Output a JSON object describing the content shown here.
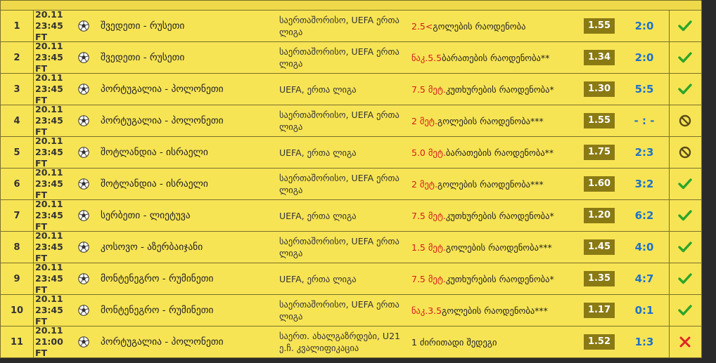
{
  "colors": {
    "row_bg": "#f7e455",
    "odds_bg": "#8a7a14",
    "score": "#1e73c8",
    "highlight": "#d61b1b",
    "win": "#2aa52a",
    "void": "#5a4a14",
    "loss": "#e02424"
  },
  "rows": [
    {
      "num": "1",
      "date": "20.11",
      "time": "23:45 FT",
      "match": "შვედეთი - რუსეთი",
      "league": "საერთაშორისო, UEFA ერთა ლიგა",
      "bet_highlight": "2.5<",
      "bet_rest": " გოლების რაოდენობა",
      "odds": "1.55",
      "score": "2:0",
      "status_icon": "check-icon"
    },
    {
      "num": "2",
      "date": "20.11",
      "time": "23:45 FT",
      "match": "შვედეთი - რუსეთი",
      "league": "საერთაშორისო, UEFA ერთა ლიგა",
      "bet_highlight": "ნაკ.5.5",
      "bet_rest": " ბარათების რაოდენობა**",
      "odds": "1.34",
      "score": "2:0",
      "status_icon": "check-icon"
    },
    {
      "num": "3",
      "date": "20.11",
      "time": "23:45 FT",
      "match": "პორტუგალია - პოლონეთი",
      "league": "UEFA, ერთა ლიგა",
      "bet_highlight": "7.5 მეტ.",
      "bet_rest": " კუთხურების რაოდენობა*",
      "odds": "1.30",
      "score": "5:5",
      "status_icon": "check-icon"
    },
    {
      "num": "4",
      "date": "20.11",
      "time": "23:45 FT",
      "match": "პორტუგალია - პოლონეთი",
      "league": "საერთაშორისო, UEFA ერთა ლიგა",
      "bet_highlight": "2 მეტ.",
      "bet_rest": " გოლების რაოდენობა***",
      "odds": "1.55",
      "score": "- : -",
      "status_icon": "void-icon"
    },
    {
      "num": "5",
      "date": "20.11",
      "time": "23:45 FT",
      "match": "შოტლანდია - ისრაელი",
      "league": "UEFA, ერთა ლიგა",
      "bet_highlight": "5.0 მეტ.",
      "bet_rest": " ბარათების რაოდენობა**",
      "odds": "1.75",
      "score": "2:3",
      "status_icon": "void-icon"
    },
    {
      "num": "6",
      "date": "20.11",
      "time": "23:45 FT",
      "match": "შოტლანდია - ისრაელი",
      "league": "საერთაშორისო, UEFA ერთა ლიგა",
      "bet_highlight": "2 მეტ.",
      "bet_rest": " გოლების რაოდენობა***",
      "odds": "1.60",
      "score": "3:2",
      "status_icon": "check-icon"
    },
    {
      "num": "7",
      "date": "20.11",
      "time": "23:45 FT",
      "match": "სერბეთი - ლიეტუვა",
      "league": "UEFA, ერთა ლიგა",
      "bet_highlight": "7.5 მეტ.",
      "bet_rest": " კუთხურების რაოდენობა*",
      "odds": "1.20",
      "score": "6:2",
      "status_icon": "check-icon"
    },
    {
      "num": "8",
      "date": "20.11",
      "time": "23:45 FT",
      "match": "კოსოვო - აზერბაიჯანი",
      "league": "საერთაშორისო, UEFA ერთა ლიგა",
      "bet_highlight": "1.5 მეტ.",
      "bet_rest": " გოლების რაოდენობა***",
      "odds": "1.45",
      "score": "4:0",
      "status_icon": "check-icon"
    },
    {
      "num": "9",
      "date": "20.11",
      "time": "23:45 FT",
      "match": "მონტენეგრო - რუმინეთი",
      "league": "UEFA, ერთა ლიგა",
      "bet_highlight": "7.5 მეტ.",
      "bet_rest": " კუთხურების რაოდენობა*",
      "odds": "1.35",
      "score": "4:7",
      "status_icon": "check-icon"
    },
    {
      "num": "10",
      "date": "20.11",
      "time": "23:45 FT",
      "match": "მონტენეგრო - რუმინეთი",
      "league": "საერთაშორისო, UEFA ერთა ლიგა",
      "bet_highlight": "ნაკ.3.5",
      "bet_rest": " გოლების რაოდენობა***",
      "odds": "1.17",
      "score": "0:1",
      "status_icon": "check-icon"
    },
    {
      "num": "11",
      "date": "20.11",
      "time": "21:00 FT",
      "match": "პორტუგალია - პოლონეთი",
      "league": "საერთ. ახალგაზრდები, U21 ე.ჩ. კვალიფიკაცია",
      "bet_highlight": "",
      "bet_rest": "1 ძირითადი შედეგი",
      "odds": "1.52",
      "score": "1:3",
      "status_icon": "cross-icon"
    }
  ]
}
